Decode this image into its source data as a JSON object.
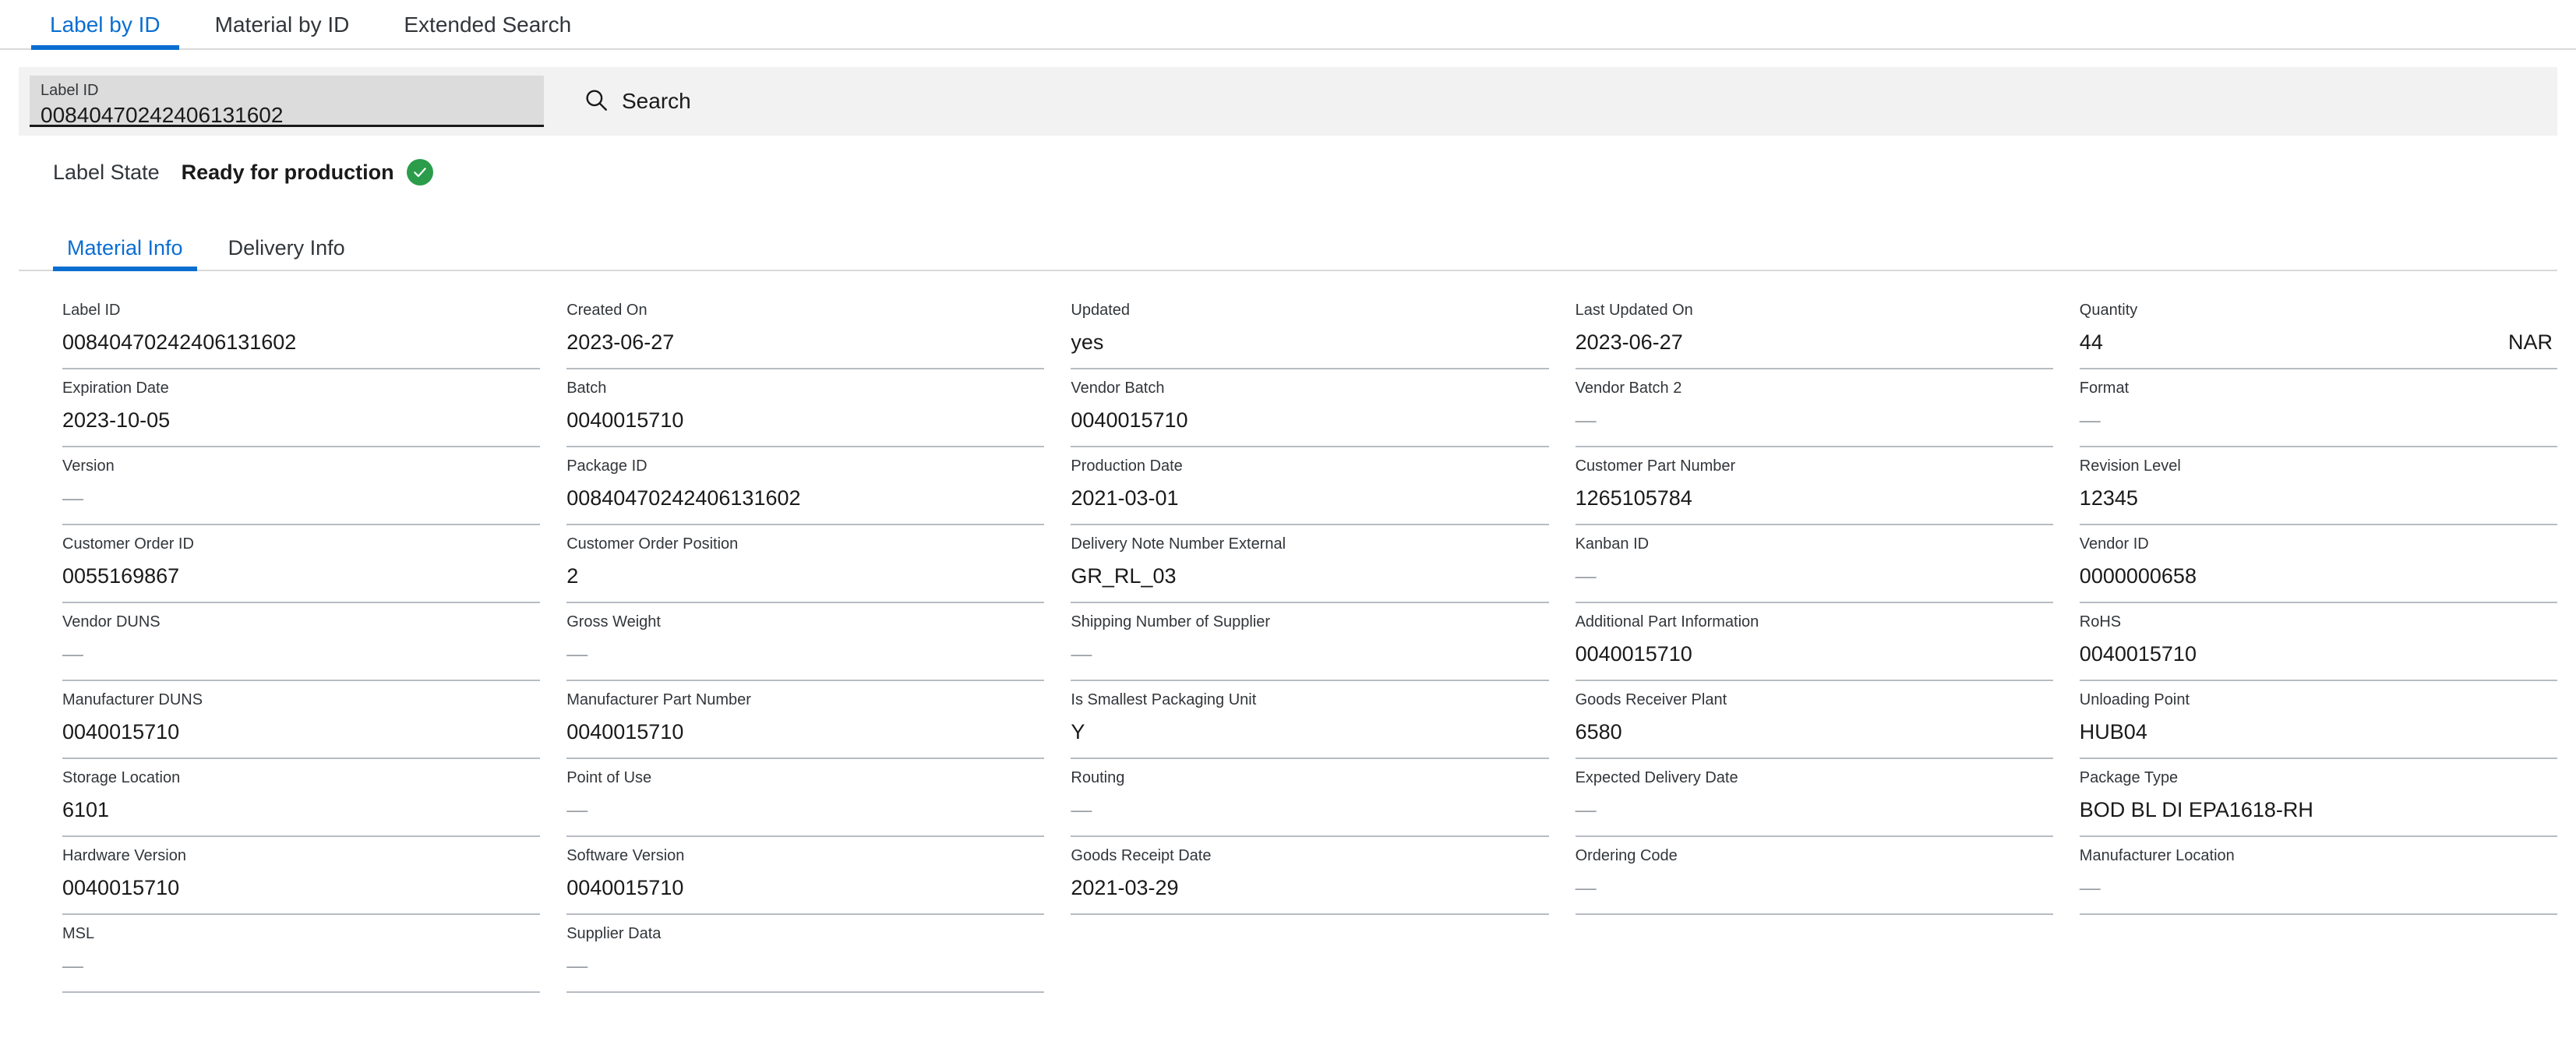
{
  "top_tabs": [
    {
      "label": "Label by ID",
      "active": true
    },
    {
      "label": "Material by ID",
      "active": false
    },
    {
      "label": "Extended Search",
      "active": false
    }
  ],
  "search": {
    "field_label": "Label ID",
    "field_value": "00840470242406131602",
    "button_label": "Search",
    "icon": "search-icon"
  },
  "label_state": {
    "key": "Label State",
    "value": "Ready for production",
    "icon": "success-check-icon",
    "icon_color": "#2b9d4a"
  },
  "sub_tabs": [
    {
      "label": "Material Info",
      "active": true
    },
    {
      "label": "Delivery Info",
      "active": false
    }
  ],
  "accent_color": "#0a6ed1",
  "empty_value": "—",
  "fields": [
    {
      "label": "Label ID",
      "value": "00840470242406131602"
    },
    {
      "label": "Created On",
      "value": "2023-06-27"
    },
    {
      "label": "Updated",
      "value": "yes"
    },
    {
      "label": "Last Updated On",
      "value": "2023-06-27"
    },
    {
      "label": "Quantity",
      "value": "44",
      "unit": "NAR"
    },
    {
      "label": "Expiration Date",
      "value": "2023-10-05"
    },
    {
      "label": "Batch",
      "value": "0040015710"
    },
    {
      "label": "Vendor Batch",
      "value": "0040015710"
    },
    {
      "label": "Vendor Batch 2",
      "value": "—"
    },
    {
      "label": "Format",
      "value": "—"
    },
    {
      "label": "Version",
      "value": "—"
    },
    {
      "label": "Package ID",
      "value": "00840470242406131602"
    },
    {
      "label": "Production Date",
      "value": "2021-03-01"
    },
    {
      "label": "Customer Part Number",
      "value": "1265105784"
    },
    {
      "label": "Revision Level",
      "value": "12345"
    },
    {
      "label": "Customer Order ID",
      "value": "0055169867"
    },
    {
      "label": "Customer Order Position",
      "value": "2"
    },
    {
      "label": "Delivery Note Number External",
      "value": "GR_RL_03"
    },
    {
      "label": "Kanban ID",
      "value": "—"
    },
    {
      "label": "Vendor ID",
      "value": "0000000658"
    },
    {
      "label": "Vendor DUNS",
      "value": "—"
    },
    {
      "label": "Gross Weight",
      "value": "—"
    },
    {
      "label": "Shipping Number of Supplier",
      "value": "—"
    },
    {
      "label": "Additional Part Information",
      "value": "0040015710"
    },
    {
      "label": "RoHS",
      "value": "0040015710"
    },
    {
      "label": "Manufacturer DUNS",
      "value": "0040015710"
    },
    {
      "label": "Manufacturer Part Number",
      "value": "0040015710"
    },
    {
      "label": "Is Smallest Packaging Unit",
      "value": "Y"
    },
    {
      "label": "Goods Receiver Plant",
      "value": "6580"
    },
    {
      "label": "Unloading Point",
      "value": "HUB04"
    },
    {
      "label": "Storage Location",
      "value": "6101"
    },
    {
      "label": "Point of Use",
      "value": "—"
    },
    {
      "label": "Routing",
      "value": "—"
    },
    {
      "label": "Expected Delivery Date",
      "value": "—"
    },
    {
      "label": "Package Type",
      "value": "BOD BL DI EPA1618-RH"
    },
    {
      "label": "Hardware Version",
      "value": "0040015710"
    },
    {
      "label": "Software Version",
      "value": "0040015710"
    },
    {
      "label": "Goods Receipt Date",
      "value": "2021-03-29"
    },
    {
      "label": "Ordering Code",
      "value": "—"
    },
    {
      "label": "Manufacturer Location",
      "value": "—"
    },
    {
      "label": "MSL",
      "value": "—"
    },
    {
      "label": "Supplier Data",
      "value": "—"
    }
  ]
}
